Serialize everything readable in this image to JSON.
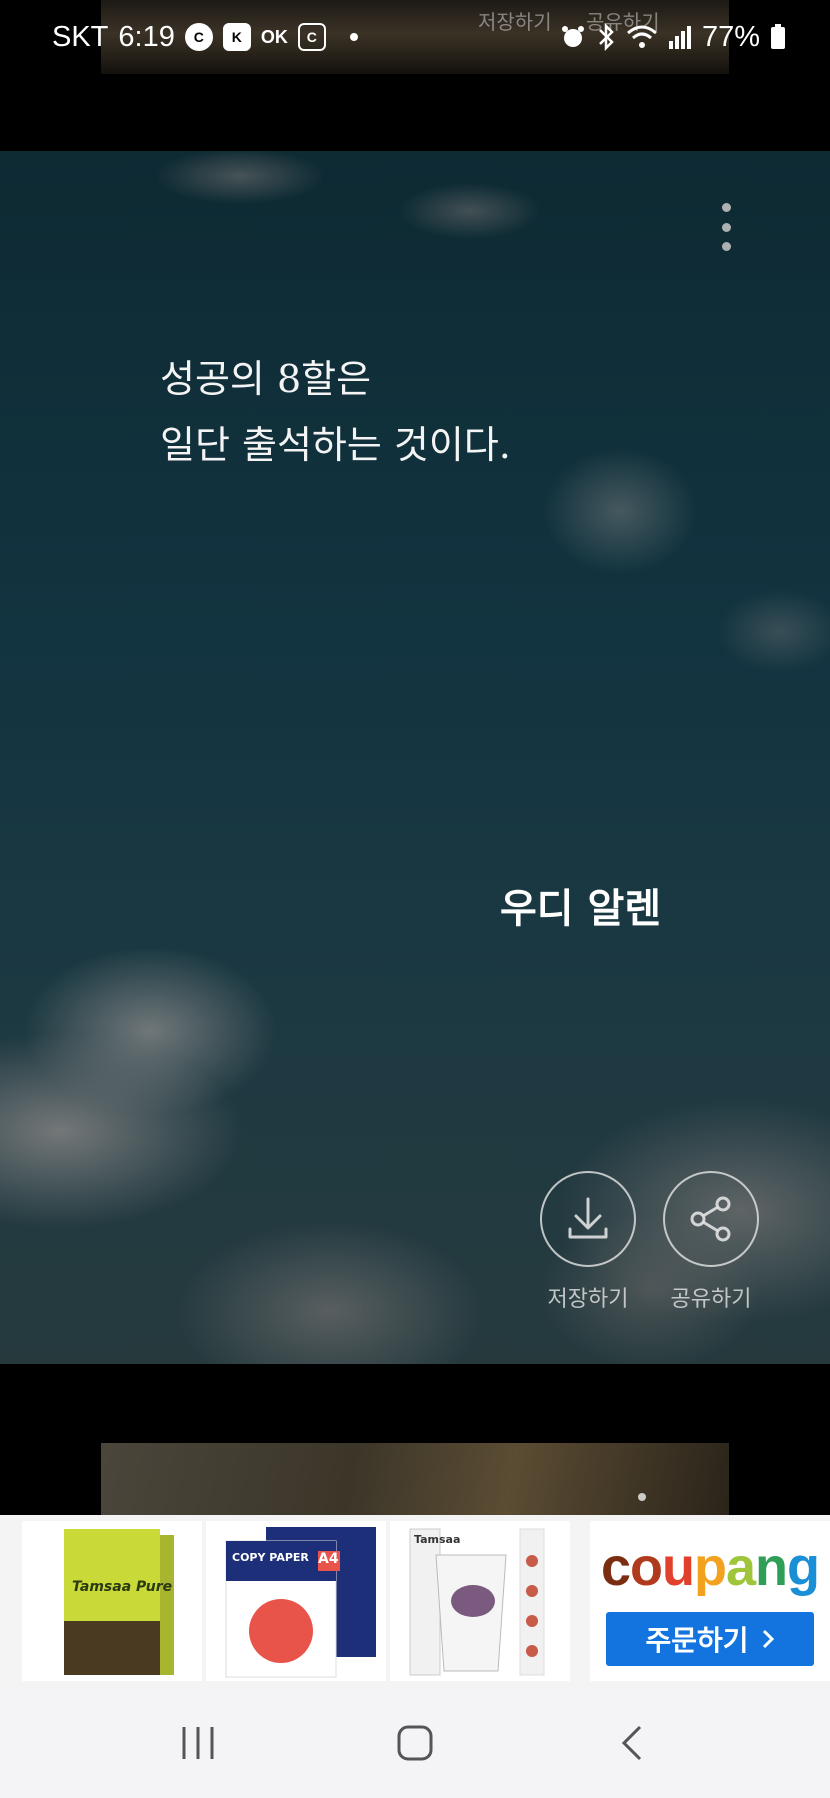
{
  "status_bar": {
    "carrier": "SKT",
    "time": "6:19",
    "battery": "77%",
    "icons": [
      "c-circle-icon",
      "k-app-icon",
      "ok-cashbag-icon",
      "card-app-icon",
      "alarm-icon",
      "bluetooth-icon",
      "wifi-icon",
      "signal-icon",
      "battery-icon"
    ],
    "badge_c": "C",
    "badge_k": "K",
    "badge_ok": "OK",
    "badge_card": "C"
  },
  "prev_card": {
    "save_label": "저장하기",
    "share_label": "공유하기"
  },
  "quote_card": {
    "quote": "성공의 8할은\n 일단 출석하는 것이다.",
    "author": "우디 알렌",
    "save_label": "저장하기",
    "share_label": "공유하기"
  },
  "ad": {
    "brand_letters": [
      "c",
      "o",
      "u",
      "p",
      "a",
      "n",
      "g"
    ],
    "brand_colors": [
      "#7b2d12",
      "#b03a1e",
      "#e0402c",
      "#f3a21f",
      "#9fc53b",
      "#2f9e57",
      "#1a8fd6"
    ],
    "cta_label": "주문하기",
    "cta_color": "#1374e0",
    "product_1_text": "Tamsaa Pure",
    "product_2_text": "COPY PAPER",
    "product_2_size": "A4",
    "product_3_text": "Tamsaa"
  }
}
